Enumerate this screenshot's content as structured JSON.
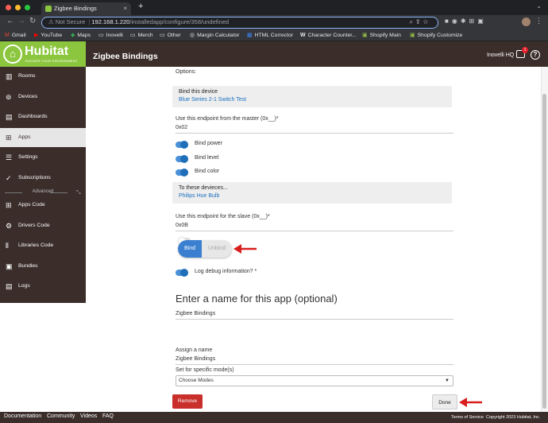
{
  "browser": {
    "tab_title": "Zigbee Bindings",
    "close_glyph": "×",
    "new_tab_glyph": "+",
    "not_secure": "Not Secure",
    "url_host": "192.168.1.220",
    "url_path": "/installedapp/configure/358/undefined",
    "bookmarks": [
      "Gmail",
      "YouTube",
      "Maps",
      "Inovelli",
      "Merch",
      "Other",
      "Margin Calculator",
      "HTML Corrector",
      "Character Counter...",
      "Shopify Main",
      "Shopify Customize"
    ]
  },
  "header": {
    "brand": "Hubitat",
    "tagline": "ELEVATE YOUR ENVIRONMENT",
    "title": "Zigbee Bindings",
    "hub_name": "Inovelli HQ",
    "notification_count": "1",
    "help_glyph": "?"
  },
  "sidebar": {
    "items": [
      {
        "label": "Rooms",
        "icon": "rooms-icon"
      },
      {
        "label": "Devices",
        "icon": "devices-icon"
      },
      {
        "label": "Dashboards",
        "icon": "dashboards-icon"
      },
      {
        "label": "Apps",
        "icon": "apps-icon"
      },
      {
        "label": "Settings",
        "icon": "settings-icon"
      },
      {
        "label": "Subscriptions",
        "icon": "subscriptions-icon"
      },
      {
        "label": "Apps Code",
        "icon": "apps-code-icon"
      },
      {
        "label": "Drivers Code",
        "icon": "drivers-code-icon"
      },
      {
        "label": "Libraries Code",
        "icon": "libraries-code-icon"
      },
      {
        "label": "Bundles",
        "icon": "bundles-icon"
      },
      {
        "label": "Logs",
        "icon": "logs-icon"
      }
    ],
    "active": "Apps",
    "advanced_label": "Advanced"
  },
  "form": {
    "options_label": "Options:",
    "bind_device_title": "Bind this device",
    "bind_device_value": "Blue Series 2-1 Switch Test",
    "master_endpoint_label": "Use this endpoint from the master (0x__)*",
    "master_endpoint_value": "0x02",
    "bind_power_label": "Bind power",
    "bind_level_label": "Bind level",
    "bind_color_label": "Bind color",
    "target_devices_title": "To these devieces...",
    "target_devices_value": "Philips Hue Bulb",
    "slave_endpoint_label": "Use this endpoint for the slave (0x__)*",
    "slave_endpoint_value": "0x0B",
    "bind_button": "Bind",
    "unbind_button": "Unbind",
    "log_debug_label": "Log debug information? *",
    "app_name_heading": "Enter a name for this app (optional)",
    "app_name_value": "Zigbee Bindings",
    "assign_name_label": "Assign a name",
    "assign_name_value": "Zigbee Bindings",
    "modes_label": "Set for specific mode(s)",
    "modes_placeholder": "Choose Modes",
    "remove_button": "Remove",
    "done_button": "Done"
  },
  "footer": {
    "links": [
      "Documentation",
      "Community",
      "Videos",
      "FAQ"
    ],
    "terms": "Terms of Service",
    "copyright": "Copyright 2023 Hubitat, Inc."
  },
  "colors": {
    "brand_green": "#8cc63f",
    "header_brown": "#3a2d2a",
    "toggle_blue": "#1e6fb8",
    "remove_red": "#c9302c",
    "annotation_arrow": "#d81e1e"
  }
}
